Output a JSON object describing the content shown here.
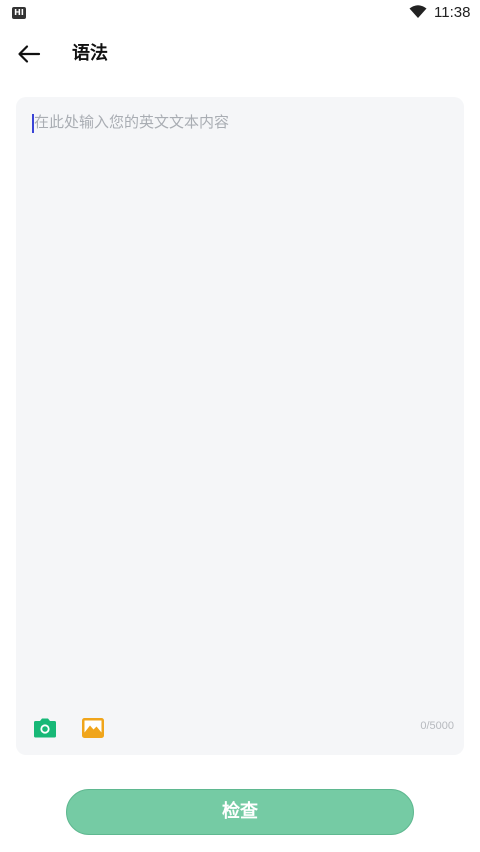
{
  "status_bar": {
    "app_icon_text": "HI",
    "time": "11:38",
    "icons": [
      "app-notification-icon",
      "wifi-icon"
    ]
  },
  "header": {
    "back_icon": "arrow-left-icon",
    "title": "语法"
  },
  "editor": {
    "placeholder": "在此处输入您的英文文本内容",
    "value": "",
    "counter": "0/5000",
    "camera_icon": "camera-icon",
    "camera_color": "#17b877",
    "image_icon": "image-icon",
    "image_color": "#f0a51b",
    "caret_color": "#3a44d6",
    "background": "#f5f6f8"
  },
  "actions": {
    "check_label": "检查",
    "check_color": "#75cba4"
  }
}
